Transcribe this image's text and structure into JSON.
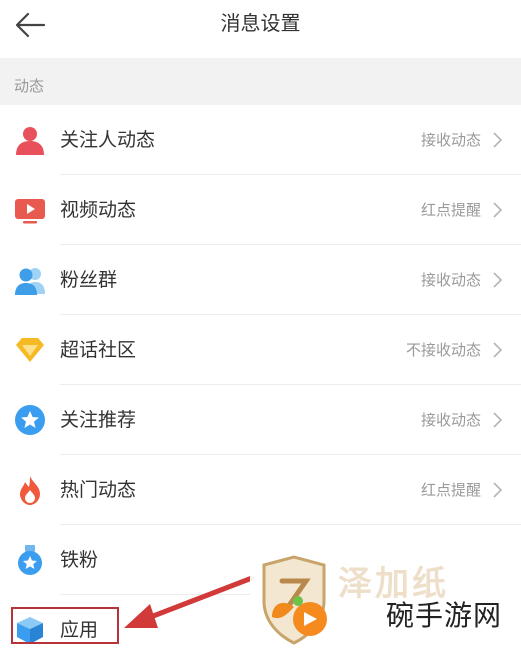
{
  "header": {
    "title": "消息设置"
  },
  "section": {
    "label": "动态"
  },
  "rows": [
    {
      "label": "关注人动态",
      "value": "接收动态",
      "icon": "person-icon"
    },
    {
      "label": "视频动态",
      "value": "红点提醒",
      "icon": "video-icon"
    },
    {
      "label": "粉丝群",
      "value": "接收动态",
      "icon": "fans-group-icon"
    },
    {
      "label": "超话社区",
      "value": "不接收动态",
      "icon": "diamond-icon"
    },
    {
      "label": "关注推荐",
      "value": "接收动态",
      "icon": "star-badge-icon"
    },
    {
      "label": "热门动态",
      "value": "红点提醒",
      "icon": "flame-icon"
    },
    {
      "label": "铁粉",
      "value": "",
      "icon": "medal-icon"
    },
    {
      "label": "应用",
      "value": "",
      "icon": "cube-icon"
    }
  ],
  "watermark": {
    "text": "碗手游网",
    "faint": "泽加纸"
  },
  "colors": {
    "annotation": "#b8323a",
    "text": "#333333",
    "secondary": "#9a9a9a"
  }
}
